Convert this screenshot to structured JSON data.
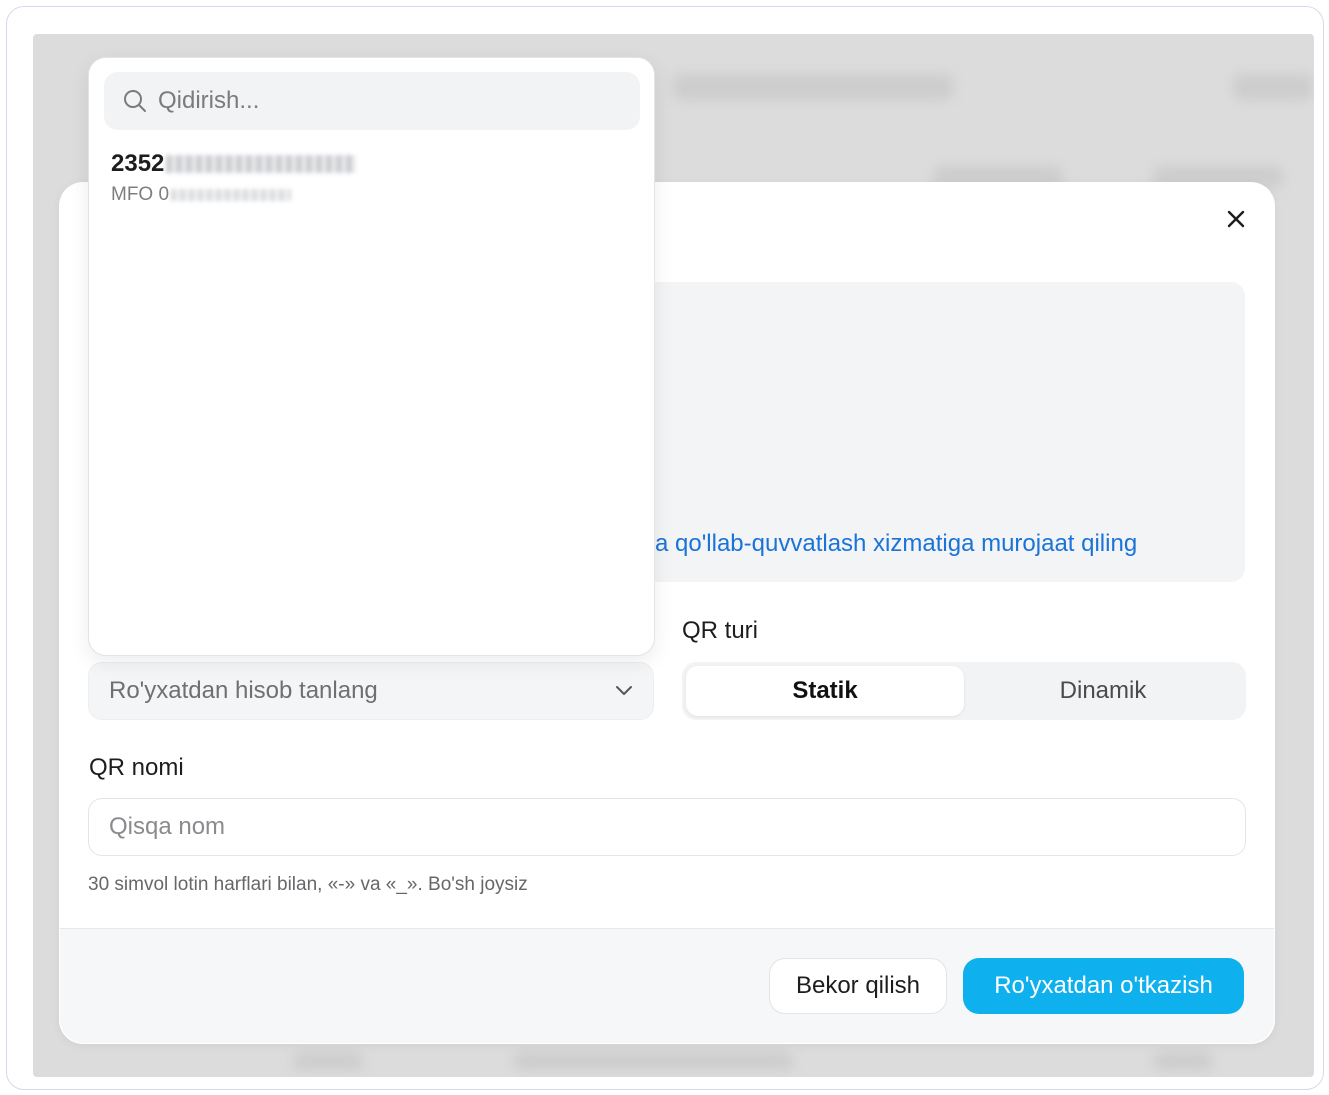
{
  "dropdown": {
    "search_placeholder": "Qidirish...",
    "option": {
      "account_visible": "2352",
      "mfo_visible": "MFO 0"
    }
  },
  "modal": {
    "close_icon": "close-icon",
    "info_link_text": "a qo'llab-quvvatlash xizmatiga murojaat qiling",
    "account_select_placeholder": "Ro'yxatdan hisob tanlang",
    "qr_type_label": "QR turi",
    "qr_type_options": [
      "Statik",
      "Dinamik"
    ],
    "qr_type_selected": "Statik",
    "qr_name_label": "QR nomi",
    "qr_name_placeholder": "Qisqa nom",
    "qr_name_hint": "30 simvol lotin harflari bilan, «-» va «_». Bo'sh joysiz",
    "cancel_label": "Bekor qilish",
    "submit_label": "Ro'yxatdan o'tkazish"
  },
  "colors": {
    "accent": "#0fb0ee",
    "link": "#1a73d9"
  }
}
